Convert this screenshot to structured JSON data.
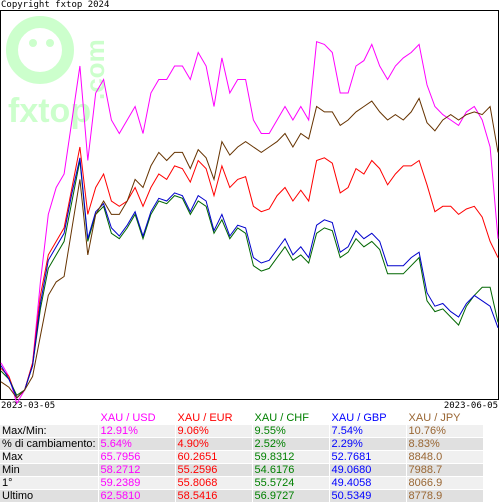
{
  "copyright": "Copyright fxtop 2024",
  "watermark": {
    "brand": "fxtop",
    "tld": ".com",
    "color": "#ccffcc"
  },
  "dates": {
    "start": "2023-03-05",
    "end": "2023-06-05"
  },
  "chart_data": {
    "type": "line",
    "title": "",
    "xlabel": "",
    "ylabel": "",
    "grid": false,
    "legend": "none",
    "x": {
      "start": "2023-03-05",
      "end": "2023-06-05",
      "points": 64
    },
    "ylim": [
      -0.3,
      14.0
    ],
    "series": [
      {
        "name": "XAU / USD",
        "color": "#ff00ff",
        "values": [
          1.0,
          0.5,
          -0.5,
          0.0,
          1.0,
          4.0,
          6.5,
          7.5,
          8.0,
          10.0,
          12.0,
          8.5,
          11.0,
          11.5,
          10.0,
          9.5,
          10.0,
          10.5,
          9.5,
          11.0,
          11.5,
          11.5,
          12.0,
          12.0,
          11.5,
          12.5,
          12.0,
          10.5,
          12.3,
          11.0,
          11.5,
          11.5,
          10.0,
          9.5,
          9.5,
          10.0,
          10.5,
          10.0,
          10.5,
          10.0,
          12.9,
          12.8,
          12.5,
          11.0,
          11.0,
          12.0,
          12.2,
          12.8,
          12.0,
          11.5,
          12.0,
          12.3,
          12.5,
          12.8,
          11.3,
          10.5,
          10.2,
          10.0,
          9.8,
          10.3,
          10.5,
          10.0,
          9.0,
          5.6
        ]
      },
      {
        "name": "XAU / EUR",
        "color": "#ff0000",
        "values": [
          0.8,
          0.5,
          -0.3,
          0.0,
          1.0,
          3.5,
          5.0,
          5.5,
          6.0,
          7.5,
          9.0,
          6.5,
          7.5,
          8.0,
          7.0,
          6.8,
          7.0,
          7.5,
          6.8,
          7.5,
          8.0,
          7.8,
          8.3,
          8.2,
          7.7,
          8.5,
          8.2,
          7.2,
          8.3,
          7.5,
          7.8,
          7.9,
          6.8,
          6.6,
          6.7,
          7.2,
          7.5,
          7.0,
          7.4,
          7.0,
          8.5,
          8.6,
          8.4,
          7.3,
          7.5,
          8.2,
          8.0,
          8.5,
          8.2,
          7.6,
          8.0,
          8.3,
          8.3,
          8.5,
          7.6,
          6.6,
          6.8,
          6.8,
          6.5,
          6.7,
          6.8,
          6.4,
          5.5,
          4.9
        ]
      },
      {
        "name": "XAU / CHF",
        "color": "#006600",
        "values": [
          0.7,
          0.4,
          -0.2,
          0.0,
          0.9,
          3.0,
          4.5,
          5.0,
          5.5,
          7.0,
          8.5,
          5.5,
          6.5,
          6.8,
          5.8,
          5.6,
          6.0,
          6.5,
          5.6,
          6.5,
          7.0,
          6.9,
          7.2,
          7.1,
          6.5,
          7.0,
          6.8,
          5.8,
          6.3,
          5.6,
          6.0,
          5.8,
          4.6,
          4.4,
          4.5,
          4.9,
          5.3,
          4.8,
          5.0,
          4.7,
          5.8,
          6.0,
          5.9,
          4.9,
          5.1,
          5.6,
          5.3,
          5.5,
          5.2,
          4.3,
          4.3,
          4.3,
          4.6,
          4.9,
          3.3,
          2.9,
          3.0,
          2.7,
          2.4,
          3.1,
          3.5,
          3.8,
          3.8,
          2.5
        ]
      },
      {
        "name": "XAU / GBP",
        "color": "#0000cc",
        "values": [
          0.9,
          0.4,
          -0.3,
          0.0,
          0.9,
          3.2,
          4.8,
          5.3,
          5.8,
          7.3,
          8.6,
          5.6,
          6.6,
          6.9,
          6.0,
          5.7,
          6.1,
          6.6,
          5.7,
          6.6,
          7.1,
          7.0,
          7.3,
          7.2,
          6.6,
          7.2,
          7.0,
          5.9,
          6.5,
          5.7,
          6.1,
          6.0,
          4.9,
          4.7,
          4.8,
          5.2,
          5.6,
          5.0,
          5.3,
          4.9,
          6.1,
          6.3,
          6.2,
          5.1,
          5.3,
          5.9,
          5.6,
          5.8,
          5.5,
          4.6,
          4.6,
          4.6,
          4.9,
          5.1,
          3.6,
          3.1,
          3.2,
          2.9,
          2.7,
          3.2,
          3.5,
          3.3,
          3.1,
          2.3
        ]
      },
      {
        "name": "XAU / JPY",
        "color": "#663300",
        "values": [
          0.3,
          0.1,
          -0.3,
          0.0,
          0.5,
          2.0,
          3.5,
          4.0,
          4.2,
          6.0,
          7.8,
          5.0,
          6.5,
          7.0,
          6.5,
          6.5,
          7.0,
          7.8,
          7.5,
          8.3,
          8.8,
          8.5,
          8.8,
          8.8,
          8.2,
          8.9,
          8.6,
          7.8,
          9.2,
          8.7,
          9.0,
          9.2,
          9.0,
          8.8,
          9.0,
          9.2,
          9.5,
          9.0,
          9.5,
          9.3,
          10.5,
          10.3,
          10.3,
          9.8,
          10.0,
          10.3,
          10.5,
          10.7,
          10.3,
          10.0,
          10.2,
          10.0,
          10.3,
          10.8,
          9.9,
          9.6,
          10.0,
          10.2,
          10.0,
          10.2,
          10.3,
          10.2,
          10.5,
          8.8
        ]
      }
    ]
  },
  "table": {
    "columns": [
      {
        "label": "XAU / USD",
        "color": "#ff00ff"
      },
      {
        "label": "XAU / EUR",
        "color": "#ff0000"
      },
      {
        "label": "XAU / CHF",
        "color": "#008000"
      },
      {
        "label": "XAU / GBP",
        "color": "#0000ff"
      },
      {
        "label": "XAU / JPY",
        "color": "#996633"
      }
    ],
    "rows": [
      {
        "label": "Max/Min:",
        "values": [
          "12.91%",
          "9.06%",
          "9.55%",
          "7.54%",
          "10.76%"
        ]
      },
      {
        "label": "% di cambiamento:",
        "values": [
          "5.64%",
          "4.90%",
          "2.52%",
          "2.29%",
          "8.83%"
        ]
      },
      {
        "label": "Max",
        "values": [
          "65.7956",
          "60.2651",
          "59.8312",
          "52.7681",
          "8848.0"
        ]
      },
      {
        "label": "Min",
        "values": [
          "58.2712",
          "55.2596",
          "54.6176",
          "49.0680",
          "7988.7"
        ]
      },
      {
        "label": "1°",
        "values": [
          "59.2389",
          "55.8068",
          "55.5724",
          "49.4058",
          "8066.9"
        ]
      },
      {
        "label": "Ultimo",
        "values": [
          "62.5810",
          "58.5416",
          "56.9727",
          "50.5349",
          "8778.9"
        ]
      }
    ]
  }
}
